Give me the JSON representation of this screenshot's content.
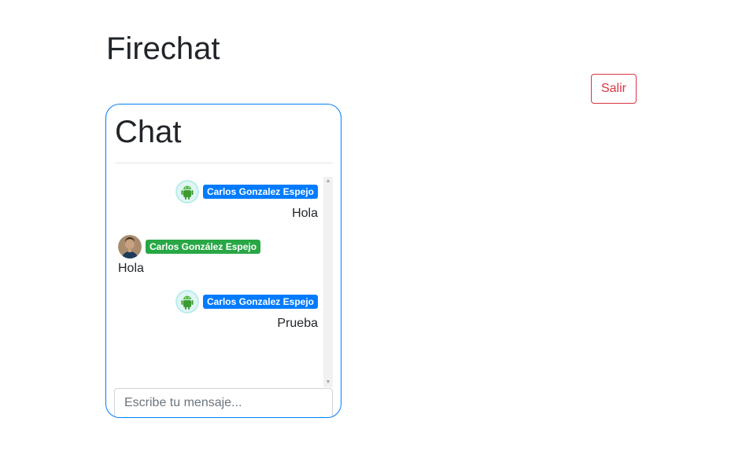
{
  "app": {
    "title": "Firechat"
  },
  "header": {
    "logout_label": "Salir"
  },
  "chat": {
    "title": "Chat",
    "messages": [
      {
        "author": "Carlos Gonzalez Espejo",
        "text": "Hola",
        "side": "right",
        "badge_color": "#007bff",
        "avatar": "android-avatar-icon"
      },
      {
        "author": "Carlos González Espejo",
        "text": "Hola",
        "side": "left",
        "badge_color": "#28a745",
        "avatar": "user-photo-avatar"
      },
      {
        "author": "Carlos Gonzalez Espejo",
        "text": "Prueba",
        "side": "right",
        "badge_color": "#007bff",
        "avatar": "android-avatar-icon"
      }
    ],
    "input": {
      "placeholder": "Escribe tu mensaje...",
      "value": ""
    }
  },
  "colors": {
    "accent": "#007bff",
    "danger": "#dc3545",
    "success": "#28a745"
  }
}
